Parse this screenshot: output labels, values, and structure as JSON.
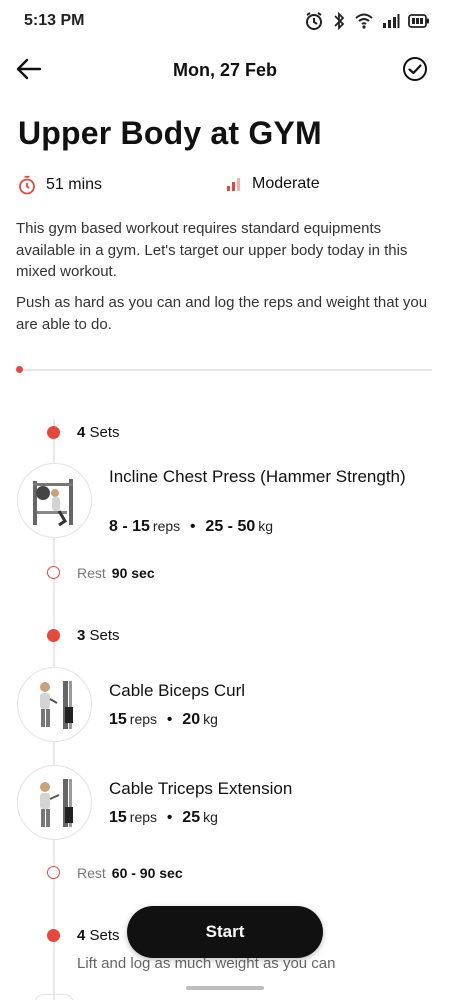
{
  "status_bar": {
    "time": "5:13 PM",
    "icons": [
      "alarm-icon",
      "bluetooth-icon",
      "wifi-icon",
      "signal-icon",
      "battery-icon"
    ]
  },
  "header": {
    "date": "Mon, 27 Feb",
    "back_icon": "arrow-left-icon",
    "check_icon": "check-circle-icon"
  },
  "workout": {
    "title": "Upper Body at GYM",
    "duration": "51 mins",
    "intensity": "Moderate",
    "description_1": "This gym based workout requires standard equipments available in a gym. Let's target our upper body today in this mixed workout.",
    "description_2": "Push as hard as you can and log the reps and weight that you are able to do.",
    "progress": 0
  },
  "colors": {
    "accent": "#e8473c",
    "button_bg": "#111111"
  },
  "blocks": [
    {
      "sets_num": "4",
      "sets_word": "Sets",
      "exercises": [
        {
          "name": "Incline Chest Press (Hammer Strength)",
          "reps": "8 - 15",
          "reps_unit": "reps",
          "weight": "25 - 50",
          "weight_unit": "kg"
        }
      ],
      "rest_label": "Rest",
      "rest_value": "90 sec"
    },
    {
      "sets_num": "3",
      "sets_word": "Sets",
      "exercises": [
        {
          "name": "Cable Biceps Curl",
          "reps": "15",
          "reps_unit": "reps",
          "weight": "20",
          "weight_unit": "kg"
        },
        {
          "name": "Cable Triceps Extension",
          "reps": "15",
          "reps_unit": "reps",
          "weight": "25",
          "weight_unit": "kg"
        }
      ],
      "rest_label": "Rest",
      "rest_value": "60 - 90 sec"
    },
    {
      "sets_num": "4",
      "sets_word": "Sets",
      "note": "Lift and log as much weight as you can"
    }
  ],
  "start_button": "Start"
}
